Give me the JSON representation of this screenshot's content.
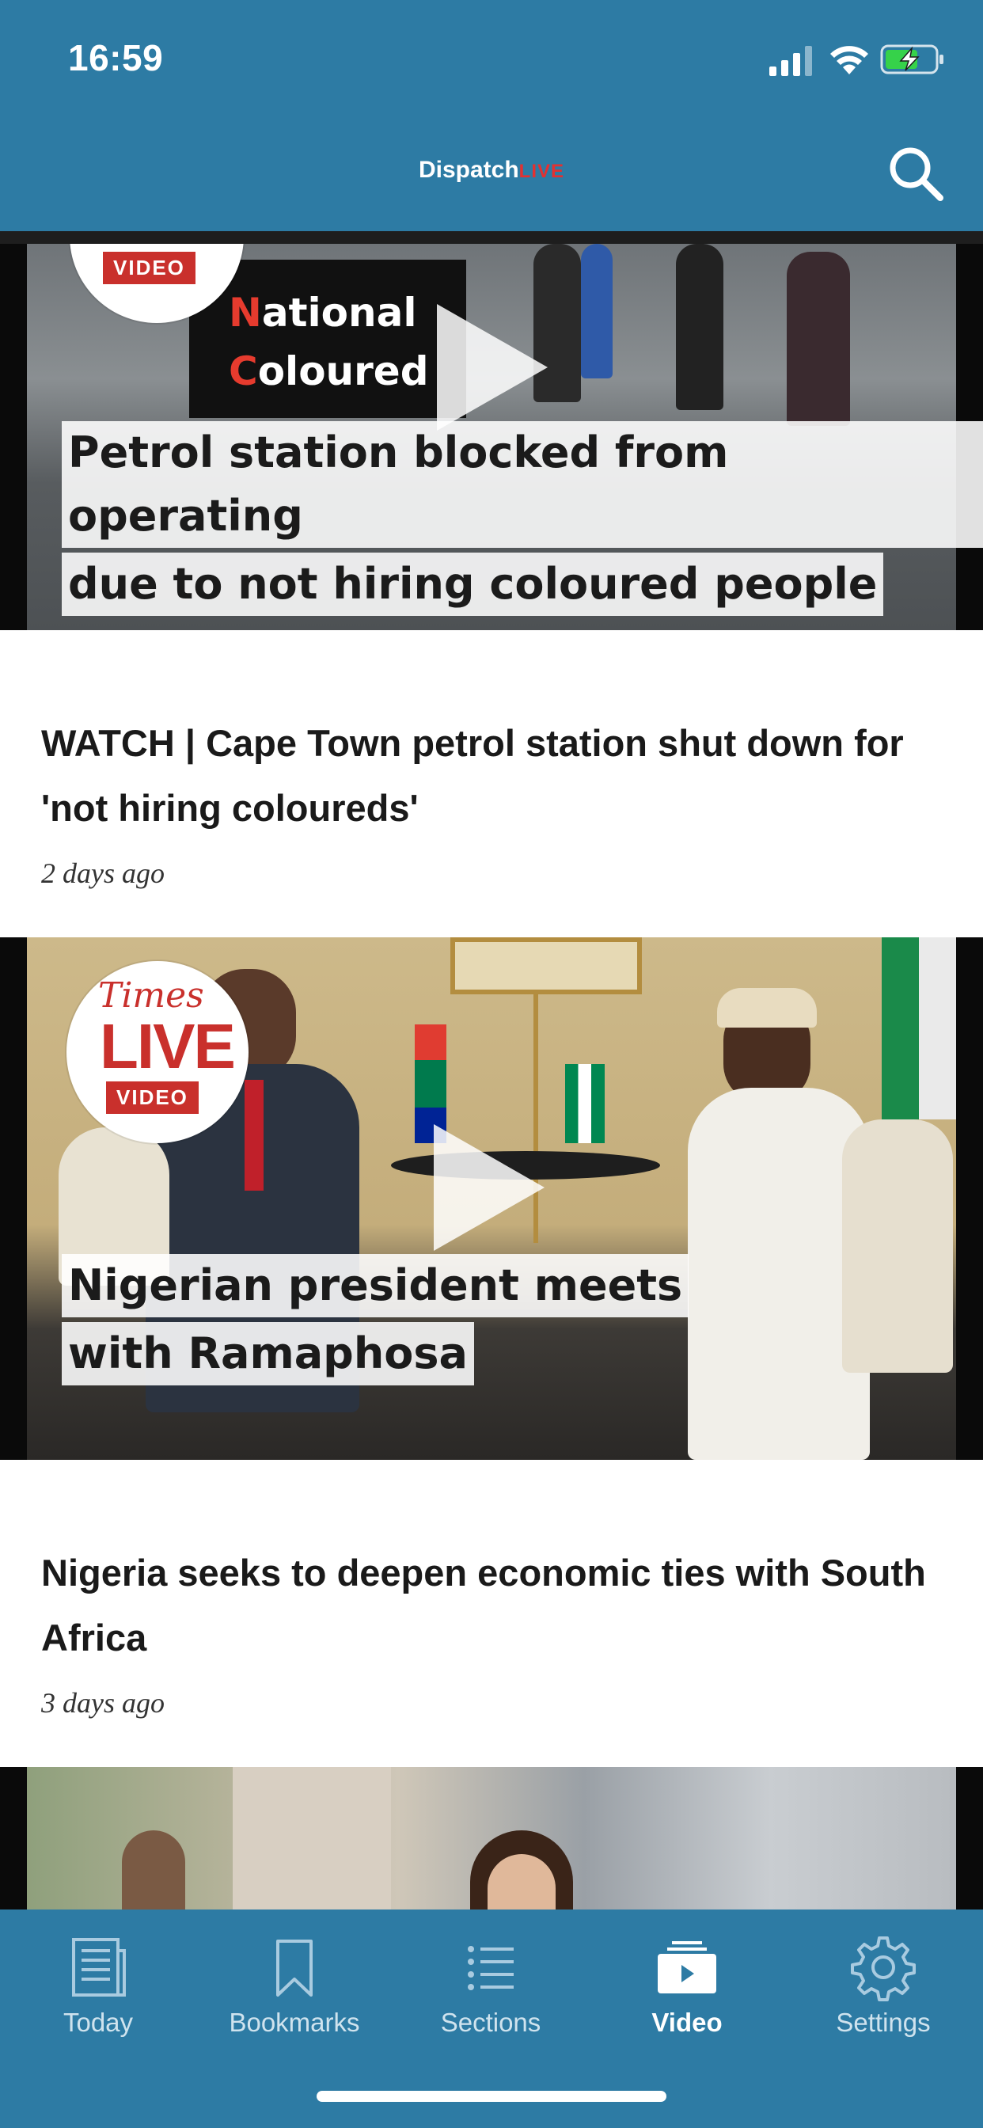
{
  "status_bar": {
    "time": "16:59"
  },
  "header": {
    "brand_main": "Dispatch",
    "brand_live": "LIVE"
  },
  "articles": [
    {
      "badge": "VIDEO",
      "banner_lines": [
        "National",
        "Coloured"
      ],
      "caption_lines": [
        "Petrol station blocked from operating",
        "due to not hiring coloured people"
      ],
      "headline": "WATCH | Cape Town petrol station shut down for 'not hiring coloureds'",
      "time_ago": "2 days ago"
    },
    {
      "badge_brand": "Times",
      "badge_live": "LIVE",
      "badge": "VIDEO",
      "caption_lines": [
        "Nigerian president meets",
        "with Ramaphosa"
      ],
      "headline": "Nigeria seeks to deepen economic ties with South Africa",
      "time_ago": "3 days ago"
    }
  ],
  "tabbar": {
    "tabs": [
      {
        "label": "Today",
        "icon": "newspaper-icon"
      },
      {
        "label": "Bookmarks",
        "icon": "bookmark-icon"
      },
      {
        "label": "Sections",
        "icon": "list-icon"
      },
      {
        "label": "Video",
        "icon": "video-icon",
        "active": true
      },
      {
        "label": "Settings",
        "icon": "gear-icon"
      }
    ]
  },
  "colors": {
    "header": "#2d7ba4",
    "accent_red": "#c9302c"
  }
}
